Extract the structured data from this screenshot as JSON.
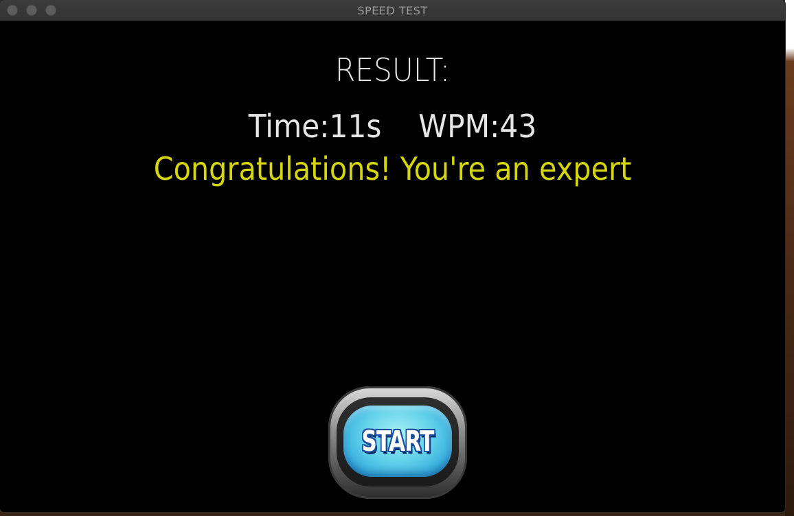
{
  "window": {
    "title": "SPEED TEST"
  },
  "result": {
    "heading": "RESULT:",
    "time_label": "Time:",
    "time_value": "11s",
    "wpm_label": "WPM:",
    "wpm_value": "43",
    "message": "Congratulations! You're an expert"
  },
  "start_button": {
    "label": "START"
  },
  "colors": {
    "background": "#000000",
    "text": "#e6e6e6",
    "message": "#d6d60e",
    "button_fill": "#62d2ea",
    "titlebar": "#383838"
  }
}
